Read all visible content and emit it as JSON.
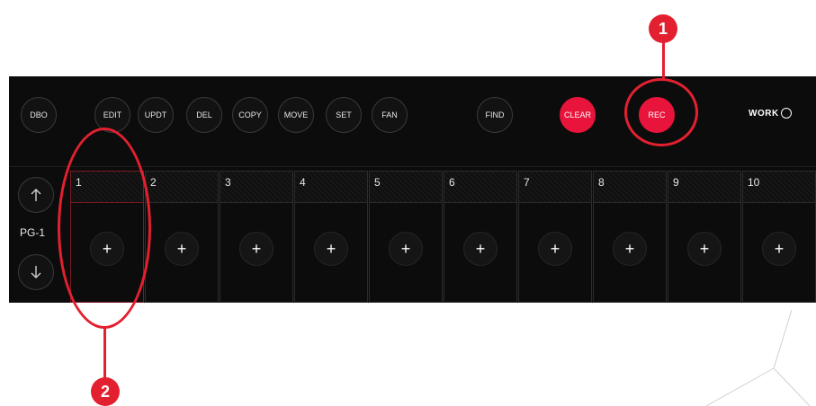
{
  "toolbar": {
    "buttons": [
      {
        "label": "DBO"
      },
      {
        "label": "EDIT"
      },
      {
        "label": "UPDT"
      },
      {
        "label": "DEL"
      },
      {
        "label": "COPY"
      },
      {
        "label": "MOVE"
      },
      {
        "label": "SET"
      },
      {
        "label": "FAN"
      },
      {
        "label": "FIND"
      },
      {
        "label": "CLEAR"
      },
      {
        "label": "REC"
      }
    ]
  },
  "logo": {
    "text": "WORK"
  },
  "pager": {
    "label": "PG-1",
    "up_icon": "arrow-up-icon",
    "down_icon": "arrow-down-icon"
  },
  "grid": {
    "cells": [
      {
        "number": "1",
        "add": "+"
      },
      {
        "number": "2",
        "add": "+"
      },
      {
        "number": "3",
        "add": "+"
      },
      {
        "number": "4",
        "add": "+"
      },
      {
        "number": "5",
        "add": "+"
      },
      {
        "number": "6",
        "add": "+"
      },
      {
        "number": "7",
        "add": "+"
      },
      {
        "number": "8",
        "add": "+"
      },
      {
        "number": "9",
        "add": "+"
      },
      {
        "number": "10",
        "add": "+"
      }
    ]
  },
  "callouts": [
    {
      "number": "1"
    },
    {
      "number": "2"
    }
  ],
  "colors": {
    "accent_red": "#e8143c",
    "callout_red": "#e32030",
    "panel_bg": "#0c0c0c"
  }
}
